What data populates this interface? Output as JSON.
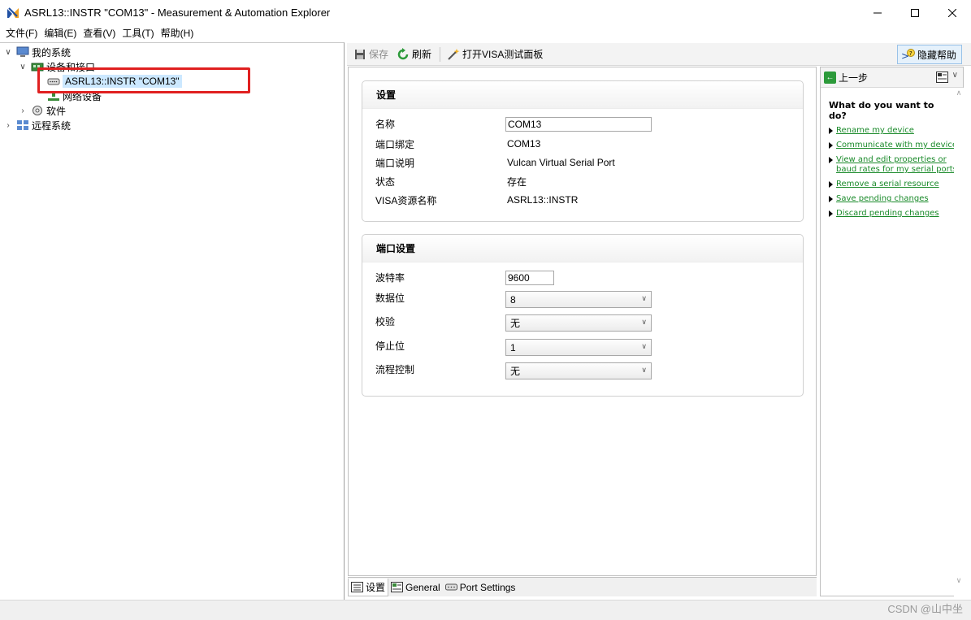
{
  "window": {
    "title": "ASRL13::INSTR \"COM13\" - Measurement & Automation Explorer"
  },
  "menu": [
    "文件(F)",
    "编辑(E)",
    "查看(V)",
    "工具(T)",
    "帮助(H)"
  ],
  "tree": {
    "my_system": "我的系统",
    "devices": "设备和接口",
    "selected_device": "ASRL13::INSTR \"COM13\"",
    "network_devices": "网络设备",
    "software": "软件",
    "remote_systems": "远程系统"
  },
  "toolbar": {
    "save": "保存",
    "refresh": "刷新",
    "open_visa": "打开VISA测试面板",
    "hide_help": "隐藏帮助"
  },
  "settings": {
    "header": "设置",
    "name_label": "名称",
    "name_value": "COM13",
    "port_binding_label": "端口绑定",
    "port_binding_value": "COM13",
    "port_desc_label": "端口说明",
    "port_desc_value": "Vulcan Virtual Serial Port",
    "status_label": "状态",
    "status_value": "存在",
    "visa_label": "VISA资源名称",
    "visa_value": "ASRL13::INSTR"
  },
  "port_settings": {
    "header": "端口设置",
    "baud_label": "波特率",
    "baud_value": "9600",
    "data_bits_label": "数据位",
    "data_bits_value": "8",
    "parity_label": "校验",
    "parity_value": "无",
    "stop_bits_label": "停止位",
    "stop_bits_value": "1",
    "flow_label": "流程控制",
    "flow_value": "无"
  },
  "tabs": [
    "设置",
    "General",
    "Port Settings"
  ],
  "help": {
    "back": "上一步",
    "title": "What do you want to do?",
    "links": [
      "Rename my device",
      "Communicate with my device",
      "View and edit properties or baud rates for my serial ports",
      "Remove a serial resource",
      "Save pending changes",
      "Discard pending changes"
    ]
  },
  "watermark": "CSDN @山中坐",
  "colors": {
    "highlight": "#e02020",
    "selection": "#cce8ff",
    "link": "#1a8a2a"
  }
}
